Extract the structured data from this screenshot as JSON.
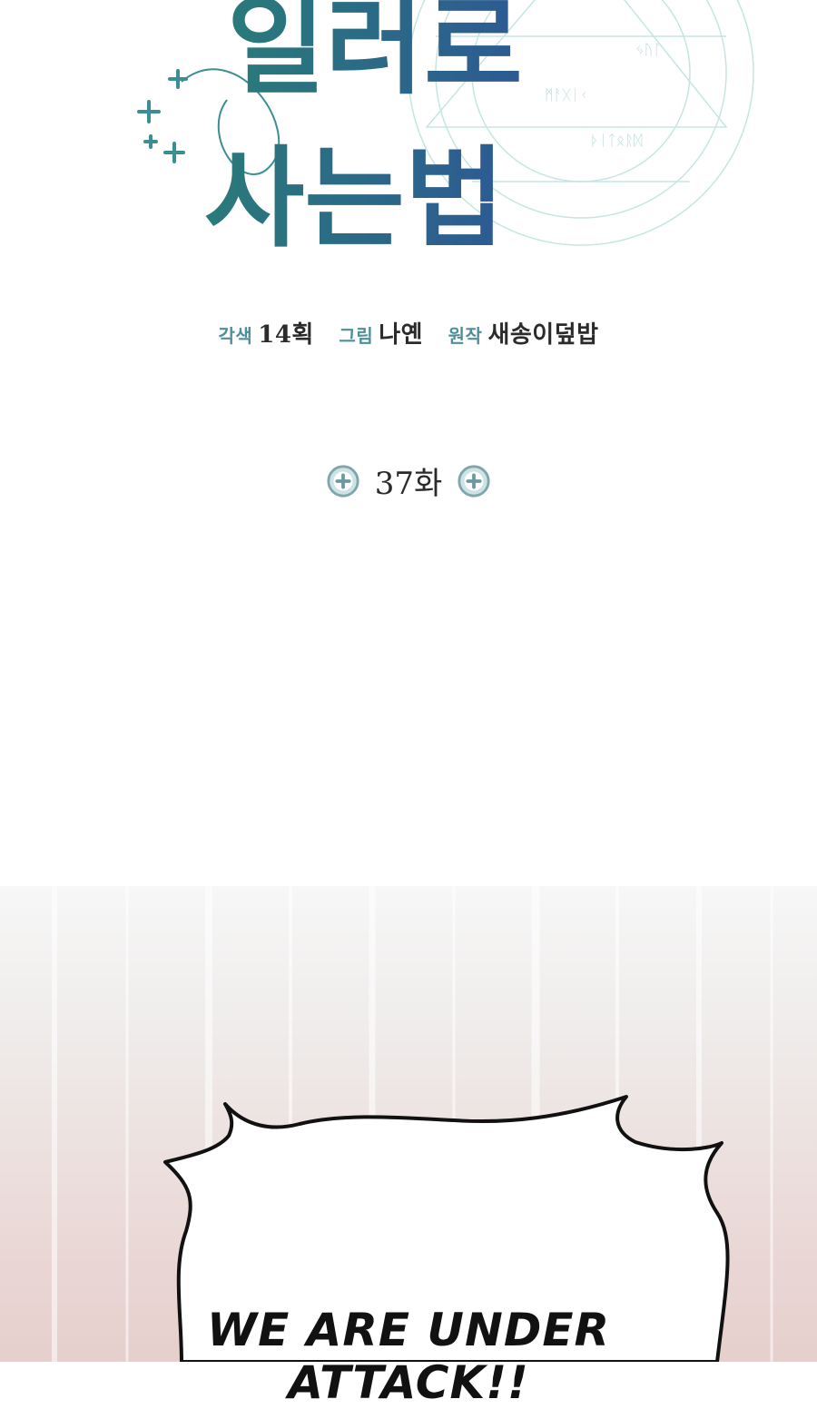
{
  "title": {
    "line1": "일러로",
    "line2": "사는법"
  },
  "credits": {
    "adapt_role": "각색",
    "adapt_name": "14획",
    "art_role": "그림",
    "art_name": "나옌",
    "original_role": "원작",
    "original_name": "새송이덮밥"
  },
  "episode": {
    "label": "37화"
  },
  "panel": {
    "speech_line1": "WE ARE UNDER",
    "speech_line2": "ATTACK!!"
  },
  "colors": {
    "title_teal": "#2f6f7a",
    "title_blue": "#2c5d8f",
    "credit_role": "#4f8f99"
  },
  "icons": {
    "badge": "plus-circle-icon"
  }
}
